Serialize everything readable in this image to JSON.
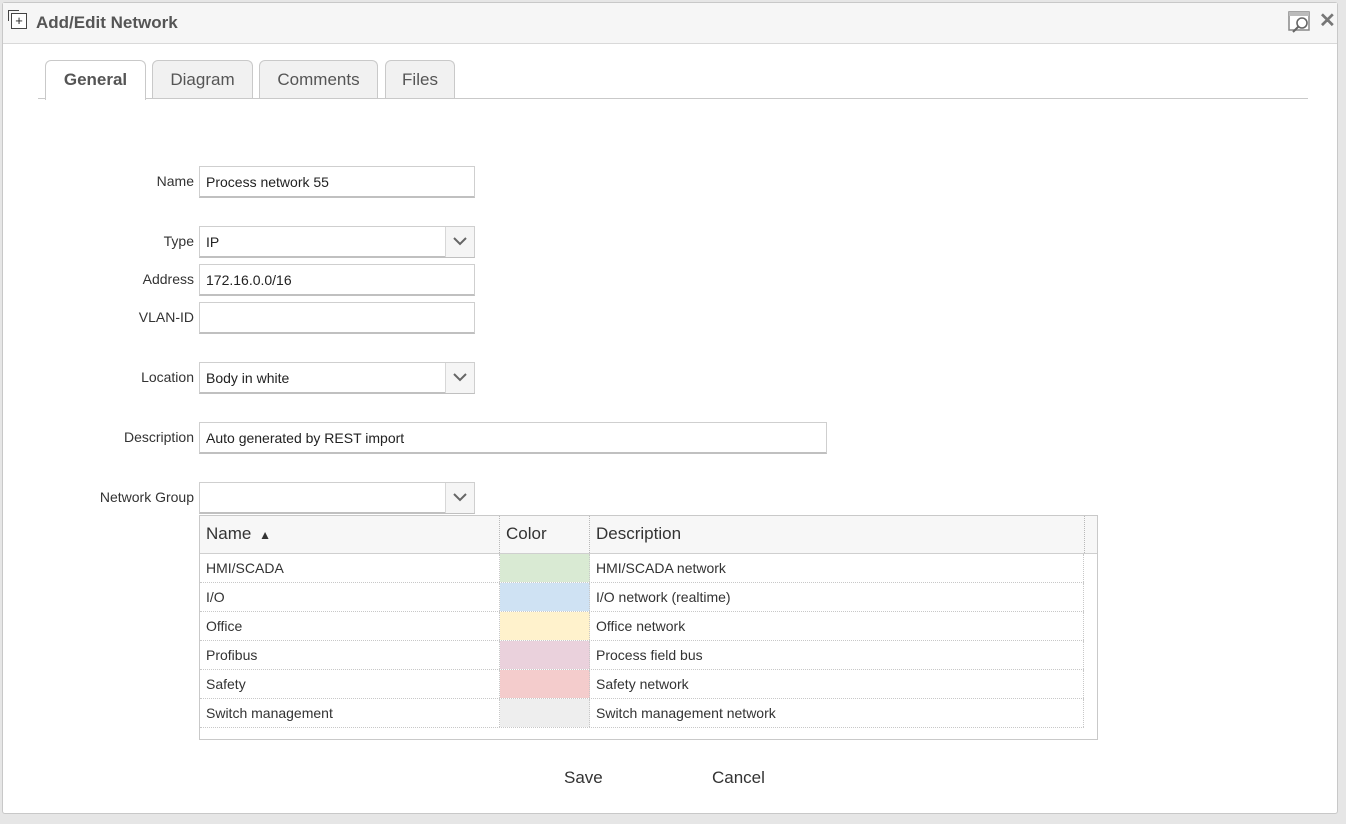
{
  "window": {
    "title": "Add/Edit Network",
    "title_icon": "add-box-icon",
    "zoom_icon": "magnifier-window-icon",
    "close_icon": "close-icon",
    "close_glyph": "✕"
  },
  "tabs": [
    {
      "label": "General",
      "active": true
    },
    {
      "label": "Diagram",
      "active": false
    },
    {
      "label": "Comments",
      "active": false
    },
    {
      "label": "Files",
      "active": false
    }
  ],
  "form": {
    "name": {
      "label": "Name",
      "value": "Process network 55"
    },
    "type": {
      "label": "Type",
      "value": "IP"
    },
    "address": {
      "label": "Address",
      "value": "172.16.0.0/16"
    },
    "vlan_id": {
      "label": "VLAN-ID",
      "value": ""
    },
    "location": {
      "label": "Location",
      "value": "Body in white"
    },
    "description": {
      "label": "Description",
      "value": "Auto generated by REST import"
    },
    "network_group": {
      "label": "Network Group",
      "value": ""
    }
  },
  "grid": {
    "columns": [
      "Name",
      "Color",
      "Description"
    ],
    "sort_indicator": "▲",
    "rows": [
      {
        "name": "HMI/SCADA",
        "color": "#d9ead3",
        "description": "HMI/SCADA network"
      },
      {
        "name": "I/O",
        "color": "#cfe2f3",
        "description": "I/O network (realtime)"
      },
      {
        "name": "Office",
        "color": "#fff2cc",
        "description": "Office network"
      },
      {
        "name": "Profibus",
        "color": "#ead1dc",
        "description": "Process field bus"
      },
      {
        "name": "Safety",
        "color": "#f4cccc",
        "description": "Safety network"
      },
      {
        "name": "Switch management",
        "color": "#eeeeee",
        "description": "Switch management network"
      }
    ]
  },
  "buttons": {
    "save": "Save",
    "cancel": "Cancel"
  }
}
